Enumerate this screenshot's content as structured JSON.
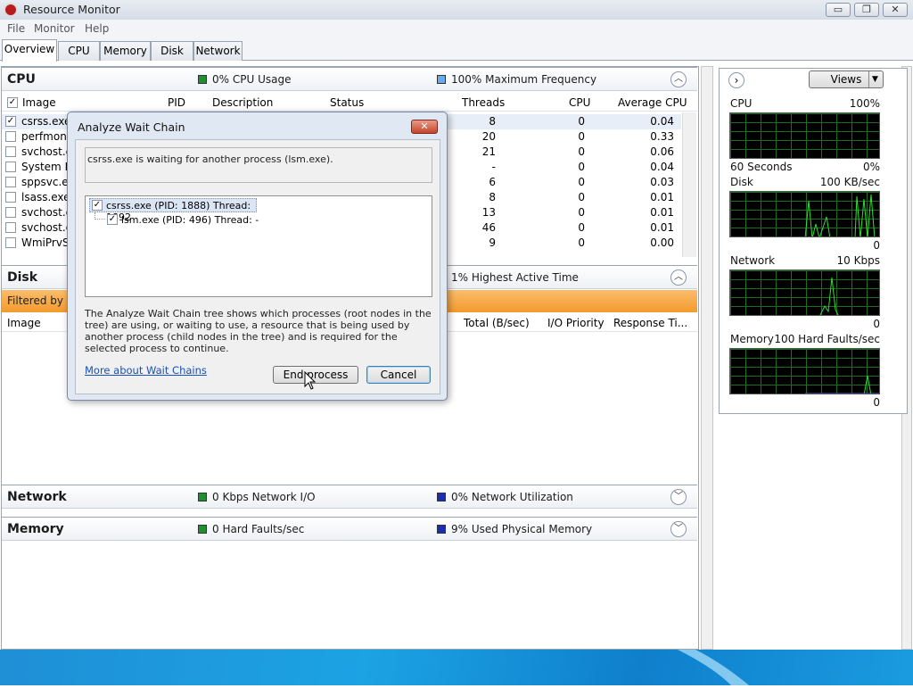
{
  "window": {
    "title": "Resource Monitor",
    "minimize": "▭",
    "restore": "❐",
    "close": "✕"
  },
  "menu": [
    "File",
    "Monitor",
    "Help"
  ],
  "tabs": [
    "Overview",
    "CPU",
    "Memory",
    "Disk",
    "Network"
  ],
  "cpu": {
    "title": "CPU",
    "usage_label": "0% CPU Usage",
    "freq_label": "100% Maximum Frequency",
    "columns": [
      "Image",
      "PID",
      "Description",
      "Status",
      "Threads",
      "CPU",
      "Average CPU"
    ],
    "rows": [
      {
        "image": "csrss.exe",
        "threads": "8",
        "cpu": "0",
        "avg": "0.04",
        "checked": true
      },
      {
        "image": "perfmon.e",
        "threads": "20",
        "cpu": "0",
        "avg": "0.33",
        "checked": false
      },
      {
        "image": "svchost.ex",
        "threads": "21",
        "cpu": "0",
        "avg": "0.06",
        "checked": false
      },
      {
        "image": "System Int",
        "threads": "-",
        "cpu": "0",
        "avg": "0.04",
        "checked": false
      },
      {
        "image": "sppsvc.exe",
        "threads": "6",
        "cpu": "0",
        "avg": "0.03",
        "checked": false
      },
      {
        "image": "lsass.exe",
        "threads": "8",
        "cpu": "0",
        "avg": "0.01",
        "checked": false
      },
      {
        "image": "svchost.ex",
        "threads": "13",
        "cpu": "0",
        "avg": "0.01",
        "checked": false
      },
      {
        "image": "svchost.ex",
        "threads": "46",
        "cpu": "0",
        "avg": "0.01",
        "checked": false
      },
      {
        "image": "WmiPrvSE",
        "threads": "9",
        "cpu": "0",
        "avg": "0.00",
        "checked": false
      }
    ]
  },
  "disk": {
    "title": "Disk",
    "active_label": "1% Highest Active Time",
    "filtered": "Filtered by cs",
    "columns": [
      "Image",
      "Total (B/sec)",
      "I/O Priority",
      "Response Ti..."
    ]
  },
  "network": {
    "title": "Network",
    "io_label": "0 Kbps Network I/O",
    "util_label": "0% Network Utilization"
  },
  "memory": {
    "title": "Memory",
    "faults_label": "0 Hard Faults/sec",
    "used_label": "9% Used Physical Memory"
  },
  "right": {
    "views": "Views",
    "graphs": [
      {
        "name": "CPU",
        "max": "100%",
        "min_left": "60 Seconds",
        "min_right": "0%"
      },
      {
        "name": "Disk",
        "max": "100 KB/sec",
        "min_left": "",
        "min_right": "0"
      },
      {
        "name": "Network",
        "max": "10 Kbps",
        "min_left": "",
        "min_right": "0"
      },
      {
        "name": "Memory",
        "max": "100 Hard Faults/sec",
        "min_left": "",
        "min_right": "0"
      }
    ]
  },
  "dialog": {
    "title": "Analyze Wait Chain",
    "close": "✕",
    "message": "csrss.exe is waiting for another process (lsm.exe).",
    "tree": [
      "csrss.exe (PID: 1888) Thread: 1892",
      "lsm.exe (PID: 496) Thread: -"
    ],
    "explanation": "The Analyze Wait Chain tree shows which processes (root nodes in the tree) are using, or waiting to use, a resource that is being used by another process (child nodes in the tree) and is required for the selected process to continue.",
    "link": "More about Wait Chains",
    "end_process": "End process",
    "cancel": "Cancel"
  },
  "colors": {
    "green_sw": "#1f8f2f",
    "blue_sw": "#6aaae8",
    "dark_blue_sw": "#1a2fb5",
    "orange_bar": "#f6a032"
  }
}
